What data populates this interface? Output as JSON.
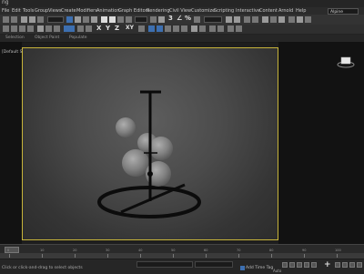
{
  "app": {
    "title": "ng"
  },
  "menu": [
    {
      "label": "File"
    },
    {
      "label": "Edit"
    },
    {
      "label": "Tools"
    },
    {
      "label": "Group"
    },
    {
      "label": "Views"
    },
    {
      "label": "Create"
    },
    {
      "label": "Modifiers"
    },
    {
      "label": "Animation"
    },
    {
      "label": "Graph Editors"
    },
    {
      "label": "Rendering"
    },
    {
      "label": "Civil View"
    },
    {
      "label": "Customize"
    },
    {
      "label": "Scripting"
    },
    {
      "label": "Interactive"
    },
    {
      "label": "Content"
    },
    {
      "label": "Arnold"
    },
    {
      "label": "Help"
    }
  ],
  "workspace": {
    "value": "Alpine"
  },
  "ribbon_tabs": [
    {
      "label": "Selection"
    },
    {
      "label": "Object Paint"
    },
    {
      "label": "Populate"
    }
  ],
  "viewport": {
    "label": "[Default Shading]"
  },
  "timeline": {
    "ticks": [
      "0",
      "10",
      "20",
      "30",
      "40",
      "50",
      "60",
      "70",
      "80",
      "90",
      "100"
    ]
  },
  "status": {
    "prompt": "Click or click-and-drag to select objects",
    "time_tag": "Add Time Tag",
    "auto_key": "Auto"
  },
  "colors": {
    "viewport_border": "#c7b43a",
    "accent": "#3d6fb0"
  }
}
